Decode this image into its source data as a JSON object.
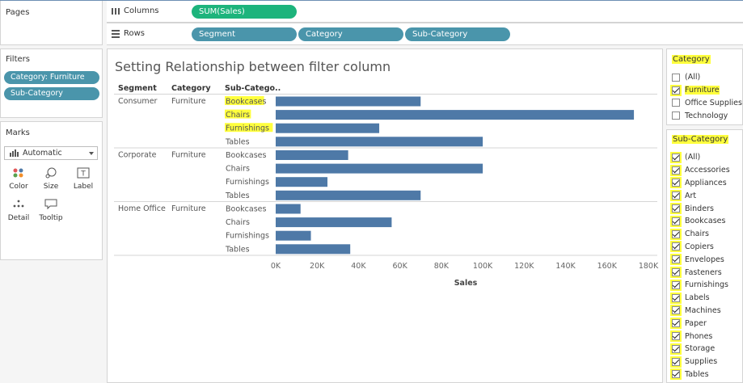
{
  "shelves": {
    "pages_label": "Pages",
    "columns_label": "Columns",
    "rows_label": "Rows",
    "columns_pills": [
      "SUM(Sales)"
    ],
    "rows_pills": [
      "Segment",
      "Category",
      "Sub-Category"
    ]
  },
  "filters": {
    "title": "Filters",
    "pills": [
      "Category: Furniture",
      "Sub-Category"
    ]
  },
  "marks": {
    "title": "Marks",
    "type_label": "Automatic",
    "buttons": [
      "Color",
      "Size",
      "Label",
      "Detail",
      "Tooltip"
    ]
  },
  "view": {
    "title": "Setting Relationship between filter column",
    "headers": {
      "segment": "Segment",
      "category": "Category",
      "subcategory": "Sub-Catego.."
    }
  },
  "chart_data": {
    "type": "bar",
    "orientation": "horizontal",
    "xlabel": "Sales",
    "xlim": [
      0,
      180000
    ],
    "xticks": [
      0,
      20000,
      40000,
      60000,
      80000,
      100000,
      120000,
      140000,
      160000,
      180000
    ],
    "xtick_labels": [
      "0K",
      "20K",
      "40K",
      "60K",
      "80K",
      "100K",
      "120K",
      "140K",
      "160K",
      "180K"
    ],
    "bar_color": "#4e79a7",
    "groups": [
      {
        "segment": "Consumer",
        "category": "Furniture",
        "subcategories": [
          "Bookcases",
          "Chairs",
          "Furnishings",
          "Tables"
        ],
        "values": [
          70000,
          173000,
          50000,
          100000
        ]
      },
      {
        "segment": "Corporate",
        "category": "Furniture",
        "subcategories": [
          "Bookcases",
          "Chairs",
          "Furnishings",
          "Tables"
        ],
        "values": [
          35000,
          100000,
          25000,
          70000
        ]
      },
      {
        "segment": "Home Office",
        "category": "Furniture",
        "subcategories": [
          "Bookcases",
          "Chairs",
          "Furnishings",
          "Tables"
        ],
        "values": [
          12000,
          56000,
          17000,
          36000
        ]
      }
    ]
  },
  "category_filter": {
    "title": "Category",
    "items": [
      {
        "label": "(All)",
        "checked": false
      },
      {
        "label": "Furniture",
        "checked": true
      },
      {
        "label": "Office Supplies",
        "checked": false
      },
      {
        "label": "Technology",
        "checked": false
      }
    ]
  },
  "subcategory_filter": {
    "title": "Sub-Category",
    "items": [
      {
        "label": "(All)",
        "checked": true
      },
      {
        "label": "Accessories",
        "checked": true
      },
      {
        "label": "Appliances",
        "checked": true
      },
      {
        "label": "Art",
        "checked": true
      },
      {
        "label": "Binders",
        "checked": true
      },
      {
        "label": "Bookcases",
        "checked": true
      },
      {
        "label": "Chairs",
        "checked": true
      },
      {
        "label": "Copiers",
        "checked": true
      },
      {
        "label": "Envelopes",
        "checked": true
      },
      {
        "label": "Fasteners",
        "checked": true
      },
      {
        "label": "Furnishings",
        "checked": true
      },
      {
        "label": "Labels",
        "checked": true
      },
      {
        "label": "Machines",
        "checked": true
      },
      {
        "label": "Paper",
        "checked": true
      },
      {
        "label": "Phones",
        "checked": true
      },
      {
        "label": "Storage",
        "checked": true
      },
      {
        "label": "Supplies",
        "checked": true
      },
      {
        "label": "Tables",
        "checked": true
      }
    ]
  },
  "colors": {
    "pill": "#4a95ab",
    "measure_pill": "#1db47c",
    "highlight": "#ffff3d"
  }
}
